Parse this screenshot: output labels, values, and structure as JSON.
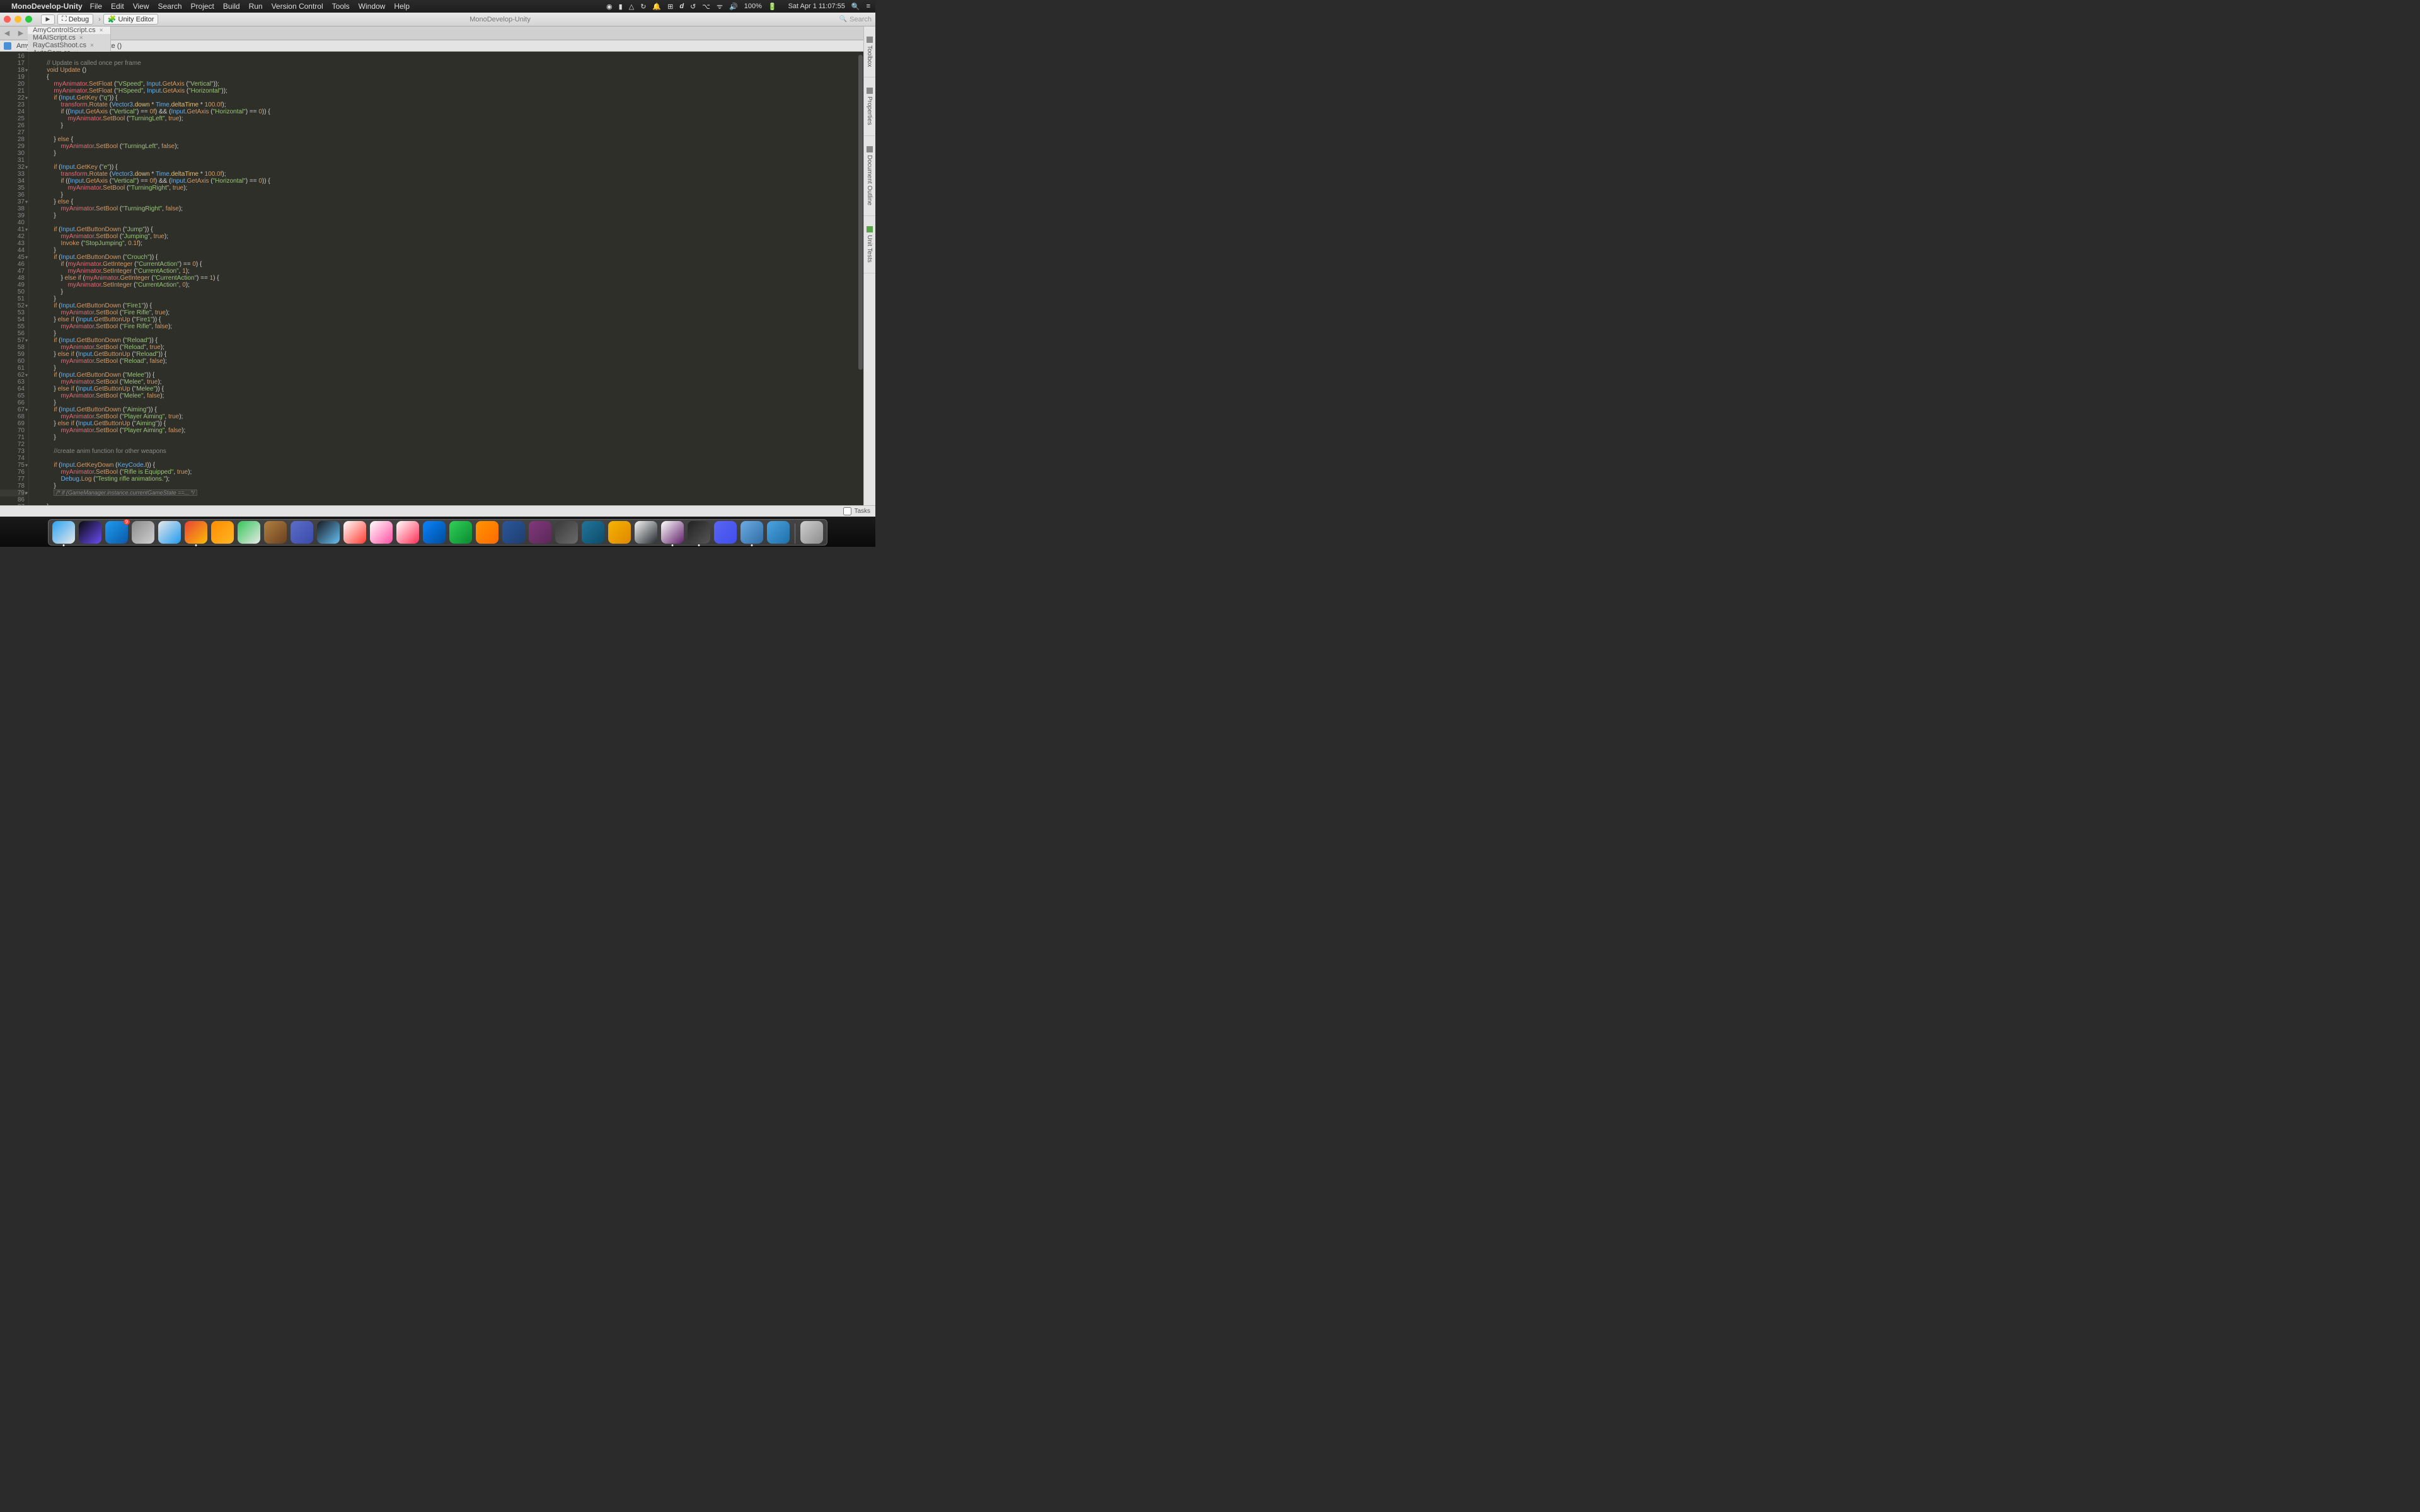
{
  "menubar": {
    "app": "MonoDevelop-Unity",
    "items": [
      "File",
      "Edit",
      "View",
      "Search",
      "Project",
      "Build",
      "Run",
      "Version Control",
      "Tools",
      "Window",
      "Help"
    ],
    "battery": "100%",
    "clock": "Sat Apr 1  11:07:55"
  },
  "toolbar": {
    "config": "Debug",
    "target": "Unity Editor",
    "title": "MonoDevelop-Unity",
    "search_placeholder": "Search"
  },
  "tabs": [
    {
      "label": "AmyControlScript.cs",
      "active": true
    },
    {
      "label": "M4AIScript.cs",
      "active": false
    },
    {
      "label": "RayCastShoot.cs",
      "active": false
    },
    {
      "label": "AutoCam.cs",
      "active": false
    }
  ],
  "breadcrumb": {
    "a": "AmyControlScript",
    "b": "Update ()"
  },
  "side_tabs": [
    "Toolbox",
    "Properties",
    "Document Outline",
    "Unit Tests"
  ],
  "tasks_label": "Tasks",
  "line_start": 16,
  "code_lines": [
    "",
    "        <cm>// Update is called once per frame</cm>",
    "        <kw>void</kw> <fn>Update</fn> ()",
    "        {",
    "            <id>myAnimator</id>.<fn>SetFloat</fn> (<st>\"VSpeed\"</st>, <ty>Input</ty>.<fn>GetAxis</fn> (<st>\"Vertical\"</st>));",
    "            <id>myAnimator</id>.<fn>SetFloat</fn> (<st>\"HSpeed\"</st>, <ty>Input</ty>.<fn>GetAxis</fn> (<st>\"Horizontal\"</st>));",
    "            <kw>if</kw> (<ty>Input</ty>.<fn>GetKey</fn> (<st>\"q\"</st>)) {",
    "                <id>transform</id>.<fn>Rotate</fn> (<ty>Vector3</ty>.<id2>down</id2> * <ty>Time</ty>.<id2>deltaTime</id2> * <nu>100.0f</nu>);",
    "                <kw>if</kw> ((<ty>Input</ty>.<fn>GetAxis</fn> (<st>\"Vertical\"</st>) == <nu>0f</nu>) && (<ty>Input</ty>.<fn>GetAxis</fn> (<st>\"Horizontal\"</st>) == <nu>0</nu>)) {",
    "                    <id>myAnimator</id>.<fn>SetBool</fn> (<st>\"TurningLeft\"</st>, <bo>true</bo>);",
    "                }",
    "",
    "            } <kw>else</kw> {",
    "                <id>myAnimator</id>.<fn>SetBool</fn> (<st>\"TurningLeft\"</st>, <bo>false</bo>);",
    "            }",
    "",
    "            <kw>if</kw> (<ty>Input</ty>.<fn>GetKey</fn> (<st>\"e\"</st>)) {",
    "                <id>transform</id>.<fn>Rotate</fn> (<ty>Vector3</ty>.<id2>down</id2> * <ty>Time</ty>.<id2>deltaTime</id2> * <nu>100.0f</nu>);",
    "                <kw>if</kw> ((<ty>Input</ty>.<fn>GetAxis</fn> (<st>\"Vertical\"</st>) == <nu>0f</nu>) && (<ty>Input</ty>.<fn>GetAxis</fn> (<st>\"Horizontal\"</st>) == <nu>0</nu>)) {",
    "                    <id>myAnimator</id>.<fn>SetBool</fn> (<st>\"TurningRight\"</st>, <bo>true</bo>);",
    "                }",
    "            } <kw>else</kw> {",
    "                <id>myAnimator</id>.<fn>SetBool</fn> (<st>\"TurningRight\"</st>, <bo>false</bo>);",
    "            }",
    "",
    "            <kw>if</kw> (<ty>Input</ty>.<fn>GetButtonDown</fn> (<st>\"Jump\"</st>)) {",
    "                <id>myAnimator</id>.<fn>SetBool</fn> (<st>\"Jumping\"</st>, <bo>true</bo>);",
    "                <fn>Invoke</fn> (<st>\"StopJumping\"</st>, <nu>0.1f</nu>);",
    "            }",
    "            <kw>if</kw> (<ty>Input</ty>.<fn>GetButtonDown</fn> (<st>\"Crouch\"</st>)) {",
    "                <kw>if</kw> (<id>myAnimator</id>.<fn>GetInteger</fn> (<st>\"CurrentAction\"</st>) == <nu>0</nu>) {",
    "                    <id>myAnimator</id>.<fn>SetInteger</fn> (<st>\"CurrentAction\"</st>, <nu>1</nu>);",
    "                } <kw>else if</kw> (<id>myAnimator</id>.<fn>GetInteger</fn> (<st>\"CurrentAction\"</st>) == <nu>1</nu>) {",
    "                    <id>myAnimator</id>.<fn>SetInteger</fn> (<st>\"CurrentAction\"</st>, <nu>0</nu>);",
    "                }",
    "            }",
    "            <kw>if</kw> (<ty>Input</ty>.<fn>GetButtonDown</fn> (<st>\"Fire1\"</st>)) {",
    "                <id>myAnimator</id>.<fn>SetBool</fn> (<st>\"Fire Rifle\"</st>, <bo>true</bo>);",
    "            } <kw>else if</kw> (<ty>Input</ty>.<fn>GetButtonUp</fn> (<st>\"Fire1\"</st>)) {",
    "                <id>myAnimator</id>.<fn>SetBool</fn> (<st>\"Fire Rifle\"</st>, <bo>false</bo>);",
    "            }",
    "            <kw>if</kw> (<ty>Input</ty>.<fn>GetButtonDown</fn> (<st>\"Reload\"</st>)) {",
    "                <id>myAnimator</id>.<fn>SetBool</fn> (<st>\"Reload\"</st>, <bo>true</bo>);",
    "            } <kw>else if</kw> (<ty>Input</ty>.<fn>GetButtonUp</fn> (<st>\"Reload\"</st>)) {",
    "                <id>myAnimator</id>.<fn>SetBool</fn> (<st>\"Reload\"</st>, <bo>false</bo>);",
    "            }",
    "            <kw>if</kw> (<ty>Input</ty>.<fn>GetButtonDown</fn> (<st>\"Melee\"</st>)) {",
    "                <id>myAnimator</id>.<fn>SetBool</fn> (<st>\"Melee\"</st>, <bo>true</bo>);",
    "            } <kw>else if</kw> (<ty>Input</ty>.<fn>GetButtonUp</fn> (<st>\"Melee\"</st>)) {",
    "                <id>myAnimator</id>.<fn>SetBool</fn> (<st>\"Melee\"</st>, <bo>false</bo>);",
    "            }",
    "            <kw>if</kw> (<ty>Input</ty>.<fn>GetButtonDown</fn> (<st>\"Aiming\"</st>)) {",
    "                <id>myAnimator</id>.<fn>SetBool</fn> (<st>\"Player Aiming\"</st>, <bo>true</bo>);",
    "            } <kw>else if</kw> (<ty>Input</ty>.<fn>GetButtonUp</fn> (<st>\"Aiming\"</st>)) {",
    "                <id>myAnimator</id>.<fn>SetBool</fn> (<st>\"Player Aiming\"</st>, <bo>false</bo>);",
    "            }",
    "",
    "            <cm>//create anim function for other weapons</cm>",
    "",
    "            <kw>if</kw> (<ty>Input</ty>.<fn>GetKeyDown</fn> (<ty>KeyCode</ty>.<id2>I</id2>)) {",
    "                <id>myAnimator</id>.<fn>SetBool</fn> (<st>\"Rifle is Equipped\"</st>, <bo>true</bo>);",
    "                <ty>Debug</ty>.<fn>Log</fn> (<st>\"Testing rifle animations.\"</st>);",
    "            }",
    "            <span class='box'>/* if (GameManager.instance.currentGameState ==... */</span>",
    "",
    "        }",
    ""
  ],
  "special_lines": {
    "skip_after": 63,
    "skip_to": 86
  },
  "fold_lines": [
    18,
    22,
    32,
    37,
    41,
    45,
    52,
    57,
    62,
    67,
    75,
    79
  ],
  "dock": [
    {
      "name": "finder",
      "c1": "#2aa4f4",
      "c2": "#e8e8e8",
      "running": true
    },
    {
      "name": "siri",
      "c1": "#0a0a0a",
      "c2": "#6b4cf6"
    },
    {
      "name": "appstore",
      "c1": "#1f9bf0",
      "c2": "#0b5aa7",
      "badge": "9"
    },
    {
      "name": "launchpad",
      "c1": "#8c8c8c",
      "c2": "#cfcfcf"
    },
    {
      "name": "safari",
      "c1": "#e8e8e8",
      "c2": "#1f9bf0"
    },
    {
      "name": "chrome",
      "c1": "#ea4335",
      "c2": "#fbbc05",
      "running": true
    },
    {
      "name": "vlc",
      "c1": "#ff8c00",
      "c2": "#ffb625"
    },
    {
      "name": "maps",
      "c1": "#34c759",
      "c2": "#e8e8e8"
    },
    {
      "name": "garageband",
      "c1": "#b08040",
      "c2": "#6b4020"
    },
    {
      "name": "clock",
      "c1": "#5b6cc9",
      "c2": "#3b4ba9"
    },
    {
      "name": "steam",
      "c1": "#171a21",
      "c2": "#66c0f4"
    },
    {
      "name": "calendar",
      "c1": "#ffffff",
      "c2": "#ff3b30"
    },
    {
      "name": "unicorn",
      "c1": "#ffffff",
      "c2": "#ff4fa3"
    },
    {
      "name": "photos",
      "c1": "#ffffff",
      "c2": "#ff2d55"
    },
    {
      "name": "keynote",
      "c1": "#0a84ff",
      "c2": "#004c99"
    },
    {
      "name": "messages",
      "c1": "#30d158",
      "c2": "#0a8a2f"
    },
    {
      "name": "ibooks",
      "c1": "#ff9500",
      "c2": "#ff6a00"
    },
    {
      "name": "word",
      "c1": "#2b579a",
      "c2": "#1e3f70"
    },
    {
      "name": "onenote",
      "c1": "#80397b",
      "c2": "#5b2858"
    },
    {
      "name": "dashboard",
      "c1": "#3a3a3a",
      "c2": "#6a6a6a"
    },
    {
      "name": "wordpress",
      "c1": "#21759b",
      "c2": "#0d4b68"
    },
    {
      "name": "kindle",
      "c1": "#f4b400",
      "c2": "#e08700"
    },
    {
      "name": "github",
      "c1": "#f5f5f5",
      "c2": "#24292e"
    },
    {
      "name": "slack",
      "c1": "#ffffff",
      "c2": "#611f69",
      "running": true
    },
    {
      "name": "unity",
      "c1": "#222222",
      "c2": "#555555",
      "running": true
    },
    {
      "name": "discord",
      "c1": "#5865f2",
      "c2": "#404eed"
    },
    {
      "name": "monodevelop",
      "c1": "#6cace4",
      "c2": "#2f6ca3",
      "running": true
    },
    {
      "name": "screensharing",
      "c1": "#4aa3df",
      "c2": "#1f6fa8"
    },
    {
      "name": "trash",
      "c1": "#cfcfcf",
      "c2": "#8c8c8c"
    }
  ]
}
